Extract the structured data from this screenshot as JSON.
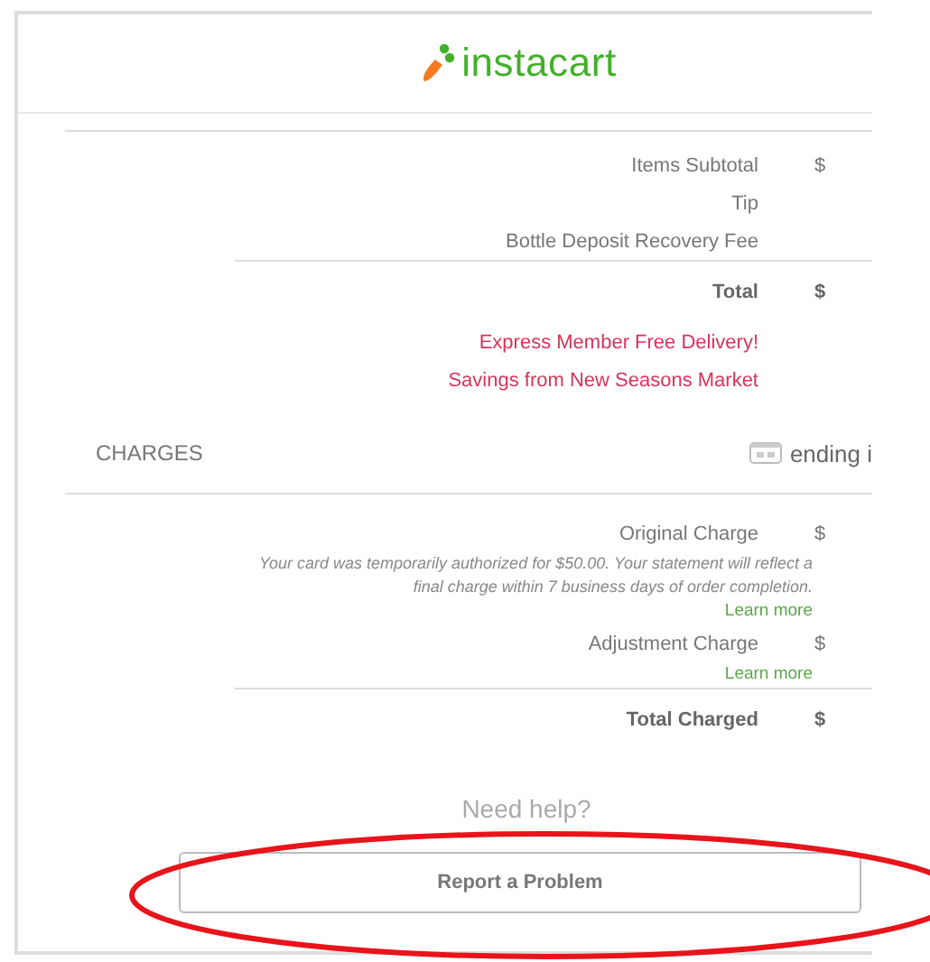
{
  "logo": {
    "text": "instacart"
  },
  "summary": {
    "rows": [
      {
        "label": "Items Subtotal",
        "amount": "$"
      },
      {
        "label": "Tip"
      },
      {
        "label": "Bottle Deposit Recovery Fee"
      }
    ],
    "total": {
      "label": "Total",
      "amount": "$"
    },
    "promos": [
      "Express Member Free Delivery!",
      "Savings from New Seasons Market"
    ]
  },
  "charges": {
    "heading": "CHARGES",
    "payment": "ending i",
    "rows": [
      {
        "label": "Original Charge",
        "amount": "$",
        "note": "Your card was temporarily authorized for $50.00. Your statement will reflect a final charge within 7 business days of order completion.",
        "link": "Learn more"
      },
      {
        "label": "Adjustment Charge",
        "amount": "$",
        "link": "Learn more"
      }
    ],
    "total": {
      "label": "Total Charged",
      "amount": "$"
    }
  },
  "help": {
    "heading": "Need help?",
    "button": "Report a Problem"
  }
}
